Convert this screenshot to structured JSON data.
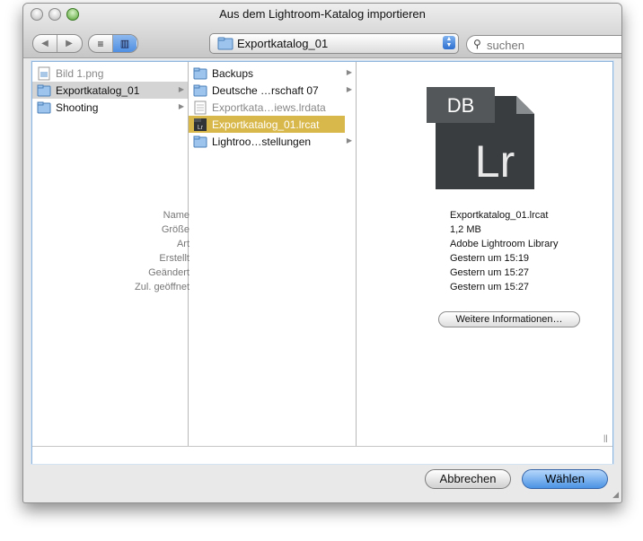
{
  "window": {
    "title": "Aus dem Lightroom-Katalog importieren"
  },
  "toolbar": {
    "back_icon": "arrow-left-icon",
    "forward_icon": "arrow-right-icon",
    "list_view_icon": "list-view-icon",
    "column_view_icon": "column-view-icon",
    "location": "Exportkatalog_01",
    "search_placeholder": "suchen"
  },
  "columns": {
    "col1": [
      {
        "label": "Bild 1.png",
        "icon": "image-file-icon",
        "state": "dim"
      },
      {
        "label": "Exportkatalog_01",
        "icon": "folder-icon",
        "state": "selected-grey",
        "has_children": true
      },
      {
        "label": "Shooting",
        "icon": "folder-icon",
        "state": "normal",
        "has_children": true
      }
    ],
    "col2": [
      {
        "label": "Backups",
        "icon": "folder-icon",
        "state": "normal",
        "has_children": true
      },
      {
        "label": "Deutsche …rschaft 07",
        "icon": "folder-icon",
        "state": "normal",
        "has_children": true
      },
      {
        "label": "Exportkata…iews.lrdata",
        "icon": "document-icon",
        "state": "dim"
      },
      {
        "label": "Exportkatalog_01.lrcat",
        "icon": "lightroom-file-icon",
        "state": "selected-gold"
      },
      {
        "label": "Lightroo…stellungen",
        "icon": "folder-icon",
        "state": "normal",
        "has_children": true
      }
    ]
  },
  "preview": {
    "icon_badge": "DB",
    "icon_text": "Lr",
    "info": [
      {
        "key": "Name",
        "value": "Exportkatalog_01.lrcat"
      },
      {
        "key": "Größe",
        "value": "1,2 MB"
      },
      {
        "key": "Art",
        "value": "Adobe Lightroom Library"
      },
      {
        "key": "Erstellt",
        "value": "Gestern um 15:19"
      },
      {
        "key": "Geändert",
        "value": "Gestern um 15:27"
      },
      {
        "key": "Zul. geöffnet",
        "value": "Gestern um 15:27"
      }
    ],
    "more_button": "Weitere Informationen…"
  },
  "buttons": {
    "cancel": "Abbrechen",
    "choose": "Wählen"
  }
}
